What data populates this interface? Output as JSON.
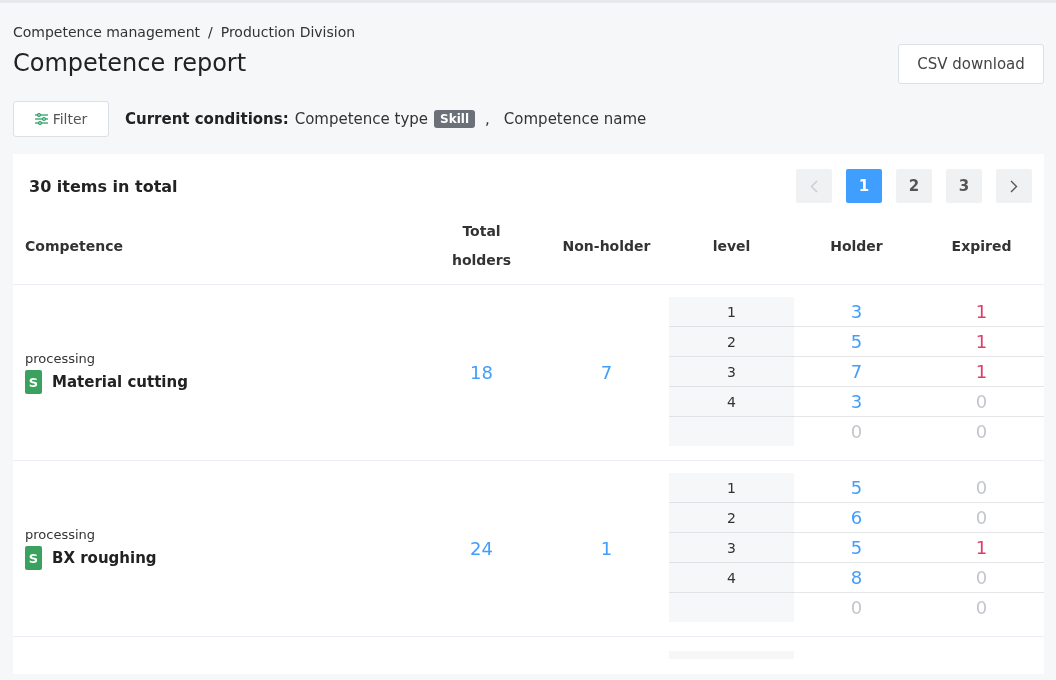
{
  "breadcrumb": {
    "items": [
      {
        "label": "Competence management"
      },
      {
        "label": "Production Division"
      }
    ],
    "separator": "/"
  },
  "title": "Competence report",
  "csv_button": "CSV download",
  "filter": {
    "button": "Filter",
    "conditions_label": "Current conditions:",
    "conditions": [
      {
        "label": "Competence type",
        "tag": "Skill"
      },
      {
        "label": "Competence name"
      }
    ],
    "separator": ","
  },
  "total": "30 items in total",
  "pagination": {
    "prev": {
      "disabled": true
    },
    "pages": [
      {
        "label": "1",
        "selected": true
      },
      {
        "label": "2",
        "selected": false
      },
      {
        "label": "3",
        "selected": false
      }
    ],
    "next": {
      "disabled": false
    }
  },
  "table": {
    "columns": [
      "Competence",
      "Total holders",
      "Non-holder",
      "level",
      "Holder",
      "Expired"
    ],
    "rows": [
      {
        "category": "processing",
        "type_badge": "S",
        "name": "Material cutting",
        "total_holders": "18",
        "non_holder": "7",
        "levels": [
          {
            "level": "1",
            "holder": {
              "value": "3",
              "muted": false
            },
            "expired": {
              "value": "1",
              "muted": false
            }
          },
          {
            "level": "2",
            "holder": {
              "value": "5",
              "muted": false
            },
            "expired": {
              "value": "1",
              "muted": false
            }
          },
          {
            "level": "3",
            "holder": {
              "value": "7",
              "muted": false
            },
            "expired": {
              "value": "1",
              "muted": false
            }
          },
          {
            "level": "4",
            "holder": {
              "value": "3",
              "muted": false
            },
            "expired": {
              "value": "0",
              "muted": true
            }
          },
          {
            "holder": {
              "value": "0",
              "muted": true
            },
            "expired": {
              "value": "0",
              "muted": true
            }
          }
        ]
      },
      {
        "category": "processing",
        "type_badge": "S",
        "name": "BX roughing",
        "total_holders": "24",
        "non_holder": "1",
        "levels": [
          {
            "level": "1",
            "holder": {
              "value": "5",
              "muted": false
            },
            "expired": {
              "value": "0",
              "muted": true
            }
          },
          {
            "level": "2",
            "holder": {
              "value": "6",
              "muted": false
            },
            "expired": {
              "value": "0",
              "muted": true
            }
          },
          {
            "level": "3",
            "holder": {
              "value": "5",
              "muted": false
            },
            "expired": {
              "value": "1",
              "muted": false
            }
          },
          {
            "level": "4",
            "holder": {
              "value": "8",
              "muted": false
            },
            "expired": {
              "value": "0",
              "muted": true
            }
          },
          {
            "holder": {
              "value": "0",
              "muted": true
            },
            "expired": {
              "value": "0",
              "muted": true
            }
          }
        ]
      }
    ]
  }
}
